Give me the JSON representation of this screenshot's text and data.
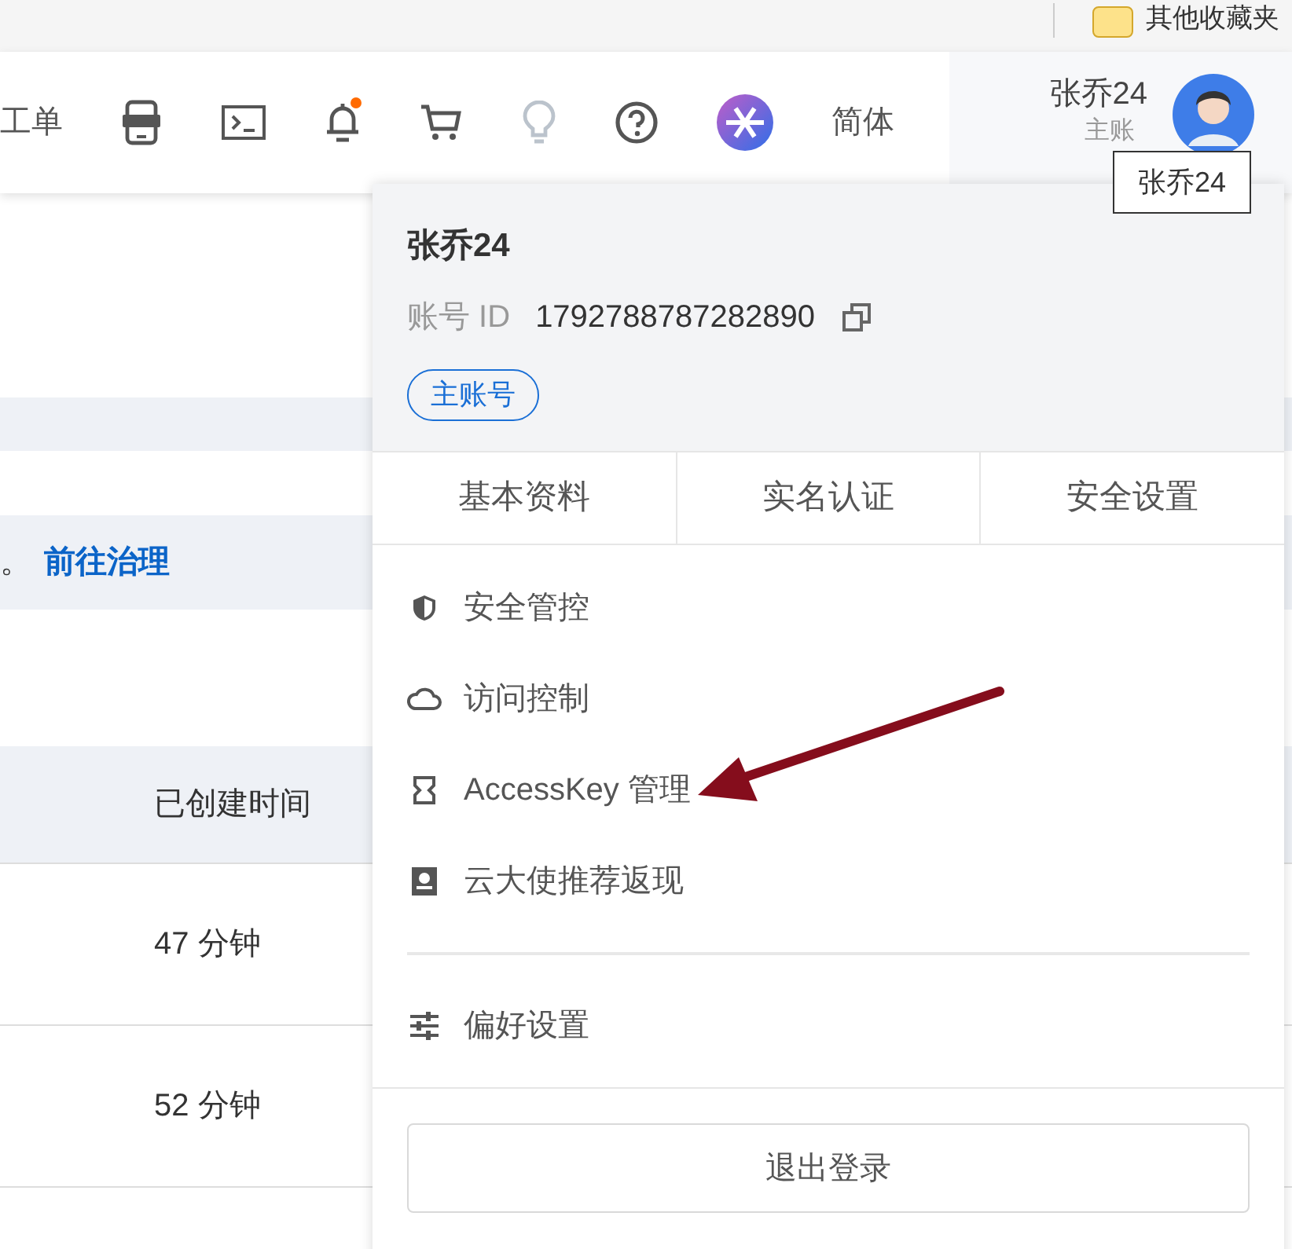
{
  "bookmarks_bar": {
    "folder": "其他收藏夹"
  },
  "header": {
    "nav_label": "工单",
    "notification_dot": true,
    "language": "简体",
    "user_name": "张乔24",
    "user_role": "主账"
  },
  "tooltip": "张乔24",
  "page": {
    "alert_text": "。",
    "alert_link": "前往治理",
    "table": {
      "columns": [
        "已创建时间"
      ],
      "rows": [
        [
          "47 分钟"
        ],
        [
          "52 分钟"
        ]
      ]
    }
  },
  "dropdown": {
    "name": "张乔24",
    "id_label": "账号 ID",
    "id_value": "1792788787282890",
    "tag": "主账号",
    "tabs": [
      "基本资料",
      "实名认证",
      "安全设置"
    ],
    "menu": [
      "安全管控",
      "访问控制",
      "AccessKey 管理",
      "云大使推荐返现"
    ],
    "preferences": "偏好设置",
    "logout": "退出登录"
  }
}
